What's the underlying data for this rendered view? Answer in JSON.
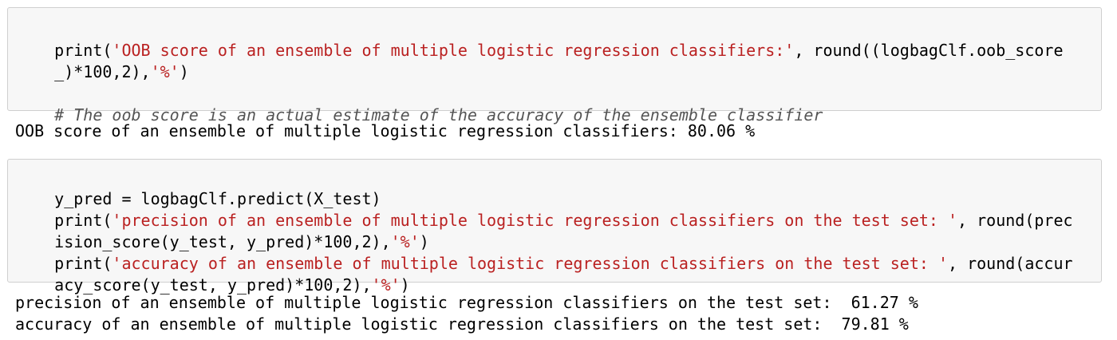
{
  "cells": [
    {
      "input_lines": [
        [
          {
            "t": "print(",
            "c": "plain"
          },
          {
            "t": "'OOB score of an ensemble of multiple logistic regression classifiers:'",
            "c": "str"
          },
          {
            "t": ", round((logbagClf.oob_score",
            "c": "plain"
          }
        ],
        [
          {
            "t": "_)*100,2),",
            "c": "plain"
          },
          {
            "t": "'%'",
            "c": "str"
          },
          {
            "t": ")",
            "c": "plain"
          }
        ],
        [],
        [
          {
            "t": "# The oob score is an actual estimate of the accuracy of the ensemble classifier",
            "c": "cmt"
          }
        ]
      ],
      "output_lines": [
        "OOB score of an ensemble of multiple logistic regression classifiers: 80.06 %"
      ]
    },
    {
      "input_lines": [
        [
          {
            "t": "y_pred = logbagClf.predict(X_test)",
            "c": "plain"
          }
        ],
        [
          {
            "t": "print(",
            "c": "plain"
          },
          {
            "t": "'precision of an ensemble of multiple logistic regression classifiers on the test set: '",
            "c": "str"
          },
          {
            "t": ", round(prec",
            "c": "plain"
          }
        ],
        [
          {
            "t": "ision_score(y_test, y_pred)*100,2),",
            "c": "plain"
          },
          {
            "t": "'%'",
            "c": "str"
          },
          {
            "t": ")",
            "c": "plain"
          }
        ],
        [
          {
            "t": "print(",
            "c": "plain"
          },
          {
            "t": "'accuracy of an ensemble of multiple logistic regression classifiers on the test set: '",
            "c": "str"
          },
          {
            "t": ", round(accur",
            "c": "plain"
          }
        ],
        [
          {
            "t": "acy_score(y_test, y_pred)*100,2),",
            "c": "plain"
          },
          {
            "t": "'%'",
            "c": "str"
          },
          {
            "t": ")",
            "c": "plain"
          }
        ]
      ],
      "output_lines": [
        "precision of an ensemble of multiple logistic regression classifiers on the test set:  61.27 %",
        "accuracy of an ensemble of multiple logistic regression classifiers on the test set:  79.81 %"
      ]
    }
  ]
}
